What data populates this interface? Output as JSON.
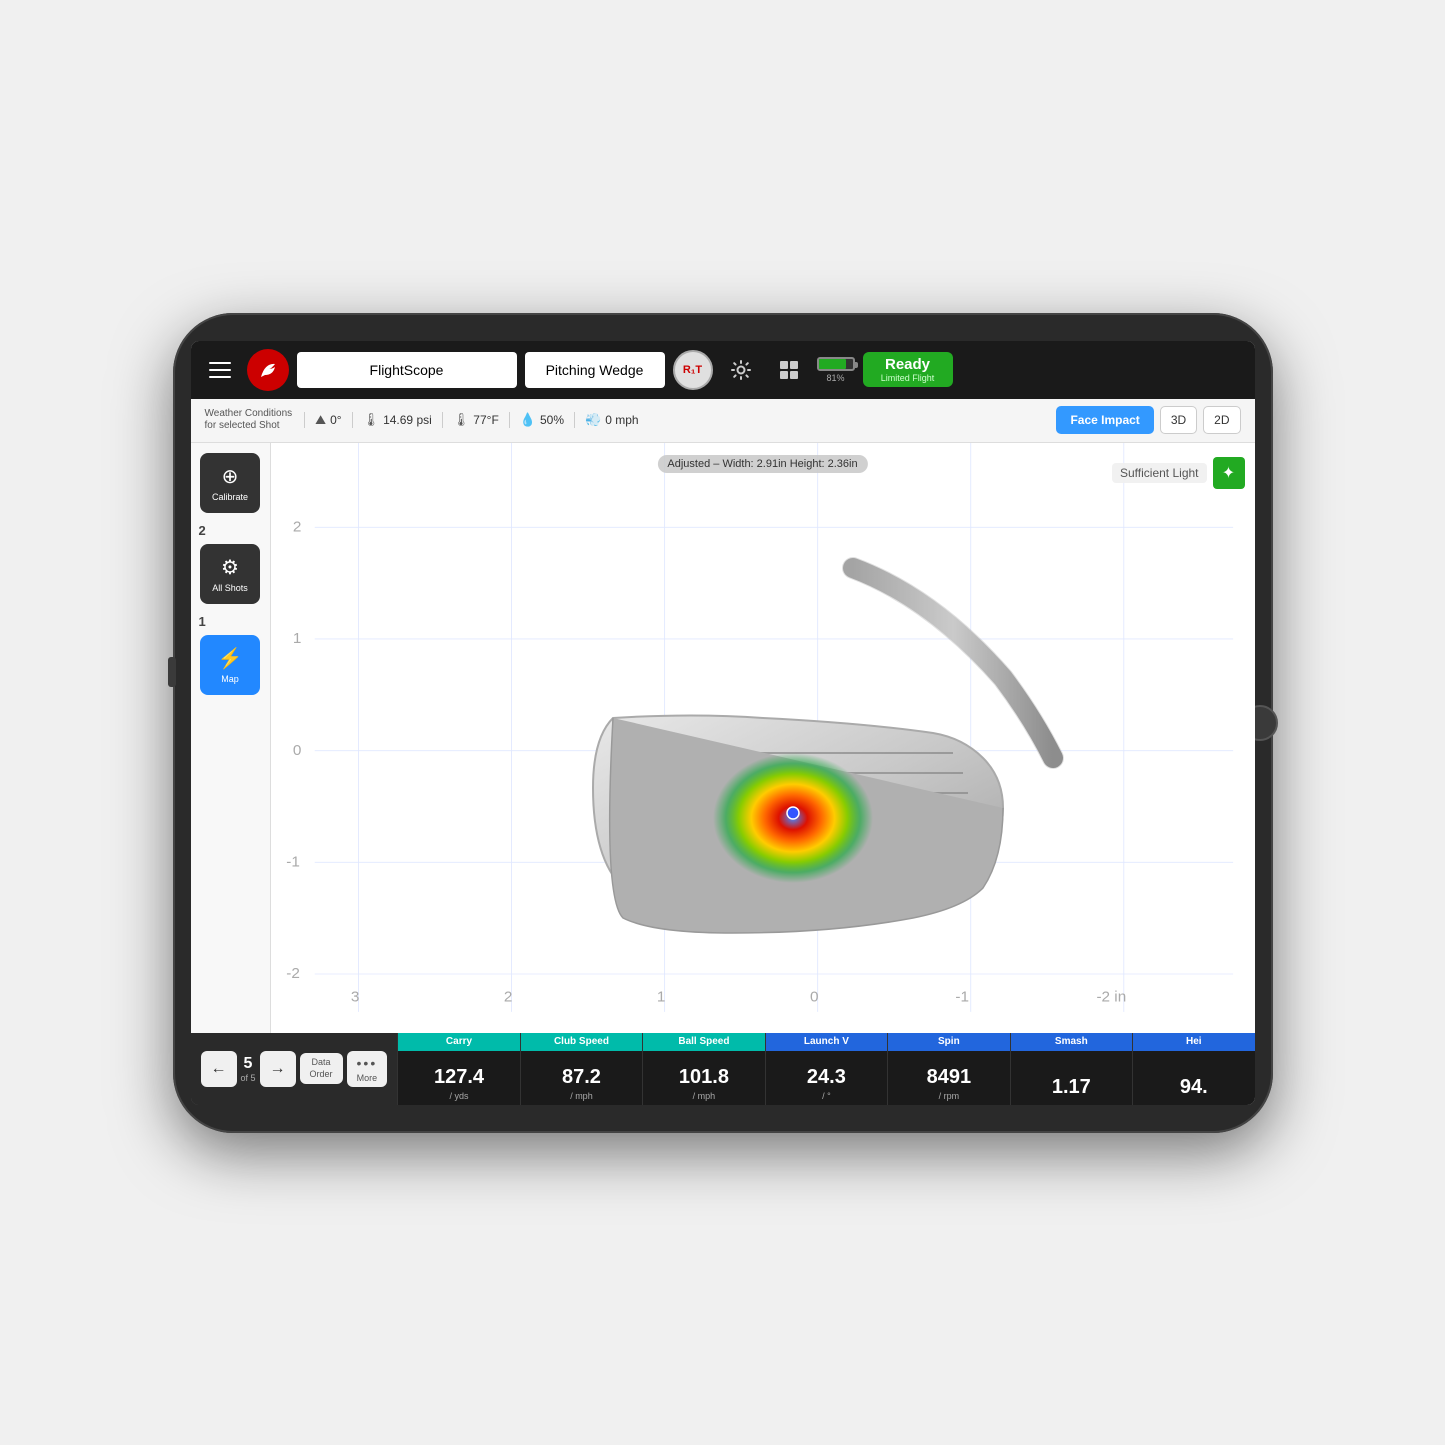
{
  "tablet": {
    "header": {
      "profile_placeholder": "FlightScope",
      "club_placeholder": "Pitching Wedge",
      "r1t_label": "R₁T",
      "ready_label": "Ready",
      "limited_flight": "Limited Flight",
      "battery_pct": "81%"
    },
    "conditions": {
      "label_line1": "Weather Conditions",
      "label_line2": "for selected Shot",
      "altitude": "0°",
      "pressure": "14.69 psi",
      "temperature": "77°F",
      "humidity": "50%",
      "wind": "0 mph"
    },
    "view_buttons": {
      "face_impact": "Face Impact",
      "three_d": "3D",
      "two_d": "2D"
    },
    "tools": {
      "calibrate": "Calibrate",
      "all_shots": "All Shots",
      "map": "Map",
      "shot_numbers": [
        "2",
        "1"
      ]
    },
    "chart": {
      "adjusted_label": "Adjusted – Width: 2.91in Height: 2.36in",
      "sufficient_light": "Sufficient Light",
      "y_labels": [
        "2",
        "1",
        "0",
        "-1",
        "-2"
      ],
      "x_labels": [
        "3",
        "2",
        "1",
        "0",
        "-1",
        "-2 in"
      ]
    },
    "navigation": {
      "prev_label": "←",
      "next_label": "→",
      "current_shot": "5",
      "of_shots": "of 5",
      "data_order_line1": "Data",
      "data_order_line2": "Order",
      "more_dots": "•••",
      "more_label": "More"
    },
    "stats": [
      {
        "header": "Carry",
        "header_style": "teal",
        "value": "127.4",
        "unit": "/ yds"
      },
      {
        "header": "Club Speed",
        "header_style": "teal",
        "value": "87.2",
        "unit": "/ mph"
      },
      {
        "header": "Ball Speed",
        "header_style": "teal",
        "value": "101.8",
        "unit": "/ mph"
      },
      {
        "header": "Launch V",
        "header_style": "blue",
        "value": "24.3",
        "unit": "/ °"
      },
      {
        "header": "Spin",
        "header_style": "blue",
        "value": "8491",
        "unit": "/ rpm"
      },
      {
        "header": "Smash",
        "header_style": "blue",
        "value": "1.17",
        "unit": ""
      },
      {
        "header": "Hei",
        "header_style": "blue",
        "value": "94.",
        "unit": ""
      }
    ]
  }
}
